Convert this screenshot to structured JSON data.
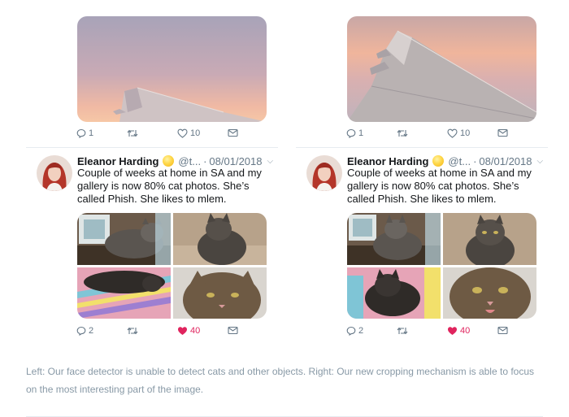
{
  "left": {
    "top_actions": {
      "replies": "1",
      "retweets": "",
      "likes": "10"
    },
    "tweet": {
      "name": "Eleanor Harding",
      "handle": "@t...",
      "date": "08/01/2018",
      "text": "Couple of weeks at home in SA and my gallery is now 80% cat photos. She’s called Phish. She likes to mlem.",
      "actions": {
        "replies": "2",
        "retweets": "",
        "likes": "40"
      }
    }
  },
  "right": {
    "top_actions": {
      "replies": "1",
      "retweets": "",
      "likes": "10"
    },
    "tweet": {
      "name": "Eleanor Harding",
      "handle": "@t...",
      "date": "08/01/2018",
      "text": "Couple of weeks at home in SA and my gallery is now 80% cat photos. She’s called Phish. She likes to mlem.",
      "actions": {
        "replies": "2",
        "retweets": "",
        "likes": "40"
      }
    }
  },
  "separator": "·",
  "caption": "Left: Our face detector is unable to detect cats and other objects. Right: Our new cropping mechanism is able to focus on the most interesting part of the image.",
  "colors": {
    "liked": "#e0245e",
    "muted": "#657786",
    "caption": "#8899a6"
  },
  "icons": [
    "reply-icon",
    "retweet-icon",
    "like-icon",
    "message-icon",
    "chevron-down-icon"
  ]
}
